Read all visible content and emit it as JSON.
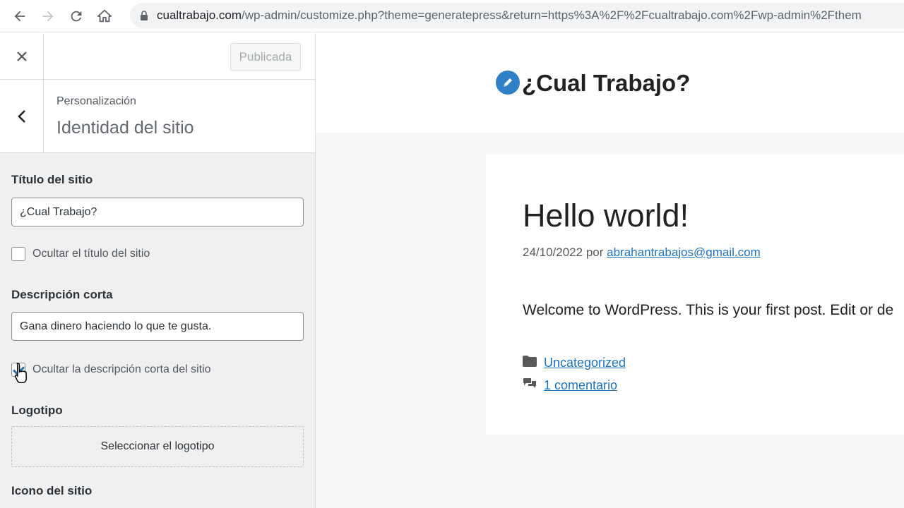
{
  "browser": {
    "url_host": "cualtrabajo.com",
    "url_path": "/wp-admin/customize.php?theme=generatepress&return=https%3A%2F%2Fcualtrabajo.com%2Fwp-admin%2Fthem"
  },
  "customizer": {
    "publish_label": "Publicada",
    "breadcrumb": "Personalización",
    "section_title": "Identidad del sitio",
    "site_title_label": "Título del sitio",
    "site_title_value": "¿Cual Trabajo?",
    "hide_title_label": "Ocultar el título del sitio",
    "hide_title_checked": false,
    "tagline_label": "Descripción corta",
    "tagline_value": "Gana dinero haciendo lo que te gusta.",
    "hide_tagline_label": "Ocultar la descripción corta del sitio",
    "hide_tagline_checked": true,
    "logo_label": "Logotipo",
    "logo_button": "Seleccionar el logotipo",
    "site_icon_label": "Icono del sitio"
  },
  "preview": {
    "site_title": "¿Cual Trabajo?",
    "post_title": "Hello world!",
    "post_date": "24/10/2022",
    "post_by": "por",
    "post_author": "abrahantrabajos@gmail.com",
    "post_excerpt": "Welcome to WordPress. This is your first post. Edit or de",
    "category": "Uncategorized",
    "comments": "1 comentario"
  },
  "colors": {
    "accent": "#2271b1",
    "link": "#1e73be",
    "site_icon": "#2f80c7"
  }
}
